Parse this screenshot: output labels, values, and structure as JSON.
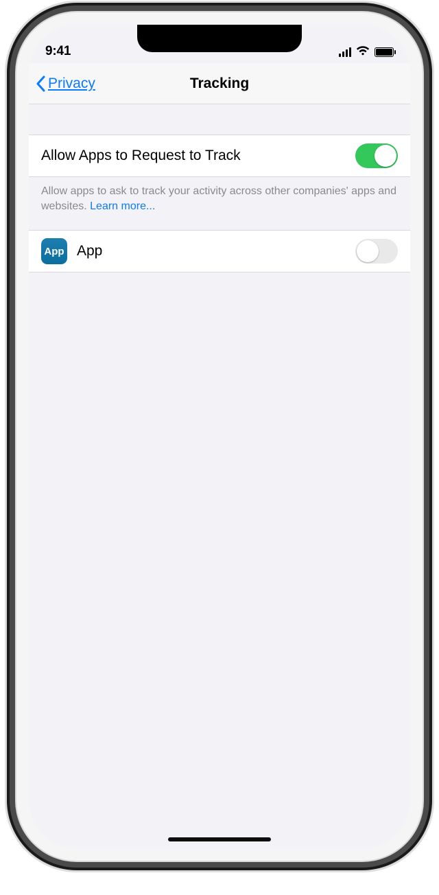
{
  "status": {
    "time": "9:41"
  },
  "nav": {
    "back_label": "Privacy",
    "title": "Tracking"
  },
  "settings": {
    "allow_row": {
      "label": "Allow Apps to Request to Track",
      "on": true
    },
    "footer": {
      "text": "Allow apps to ask to track your activity across other companies' apps and websites. ",
      "learn_more": "Learn more..."
    },
    "apps": [
      {
        "name": "App",
        "icon_label": "App",
        "on": false
      }
    ]
  }
}
